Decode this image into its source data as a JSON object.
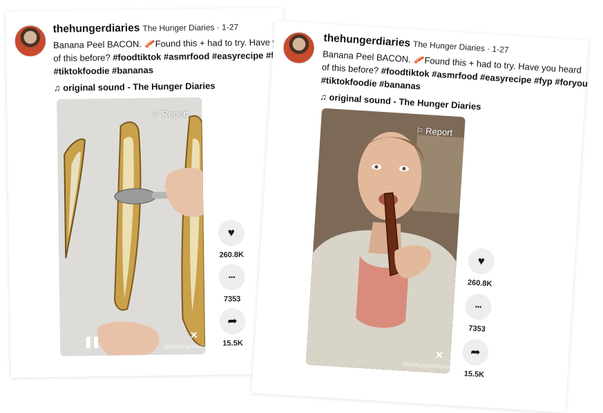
{
  "posts": [
    {
      "username": "thehungerdiaries",
      "display_meta": "The Hunger Diaries · 1-27",
      "caption_text": "Banana Peel BACON. 🥓Found this + had to try. Have you heard",
      "caption_line2": "of this before? ",
      "hashtags_line2": "#foodtiktok #asmrfood #easyrecipe #fyp",
      "hashtags_line3": "#tiktokfoodie #bananas",
      "sound": "original sound - The Hunger Diaries",
      "report": "Report",
      "watermark": "@thehungerdiaries",
      "likes": "260.8K",
      "comments": "7353",
      "shares": "15.5K"
    },
    {
      "username": "thehungerdiaries",
      "display_meta": "The Hunger Diaries · 1-27",
      "caption_text": "Banana Peel BACON. 🥓Found this + had to try. Have you heard",
      "caption_line2": "of this before? ",
      "hashtags_line2": "#foodtiktok #asmrfood #easyrecipe #fyp #foryou",
      "hashtags_line3": "#tiktokfoodie #bananas",
      "sound": "original sound - The Hunger Diaries",
      "report": "Report",
      "watermark": "@thehungerdiaries",
      "likes": "260.8K",
      "comments": "7353",
      "shares": "15.5K"
    }
  ],
  "icons": {
    "music": "♫",
    "report": "⚐",
    "heart": "♥",
    "comment": "•••",
    "share": "➦",
    "pause": "❚❚",
    "mute": "✕"
  },
  "colors": {
    "text": "#111111",
    "action_bg": "#eeeeee"
  }
}
